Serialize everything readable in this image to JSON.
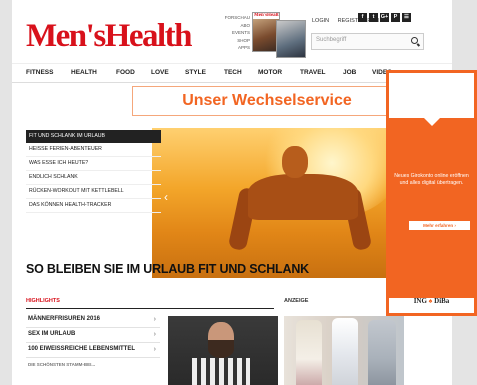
{
  "header": {
    "logo": "Men'sHealth",
    "top_links": [
      "FORSCHAU",
      "ABO",
      "EVENTS",
      "SHOP",
      "APPS"
    ],
    "magazine_mini_title": "Men'sHealth",
    "login_label": "LOGIN",
    "register_label": "REGISTRIEREN",
    "social": [
      "f",
      "t",
      "G+",
      "P",
      "RSS"
    ],
    "search_placeholder": "Suchbegriff"
  },
  "nav": {
    "items": [
      "FITNESS",
      "HEALTH",
      "FOOD",
      "LOVE",
      "STYLE",
      "TECH",
      "MOTOR",
      "TRAVEL",
      "JOB",
      "VIDEO"
    ]
  },
  "banner": {
    "text": "Unser Wechselservice"
  },
  "teasers": [
    "FIT UND SCHLANK IM URLAUB",
    "HEISSE FERIEN-ABENTEUER",
    "WAS ESSE ICH HEUTE?",
    "ENDLICH SCHLANK",
    "RÜCKEN-WORKOUT MIT KETTLEBELL",
    "DAS KÖNNEN HEALTH-TRACKER"
  ],
  "hero": {
    "title": "SO BLEIBEN SIE IM URLAUB FIT UND SCHLANK"
  },
  "highlights": {
    "heading": "HIGHLIGHTS",
    "items": [
      "MÄNNERFRISUREN 2016",
      "SEX IM URLAUB",
      "100 EIWEISSREICHE LEBENSMITTEL",
      "DIE SCHÖNSTEN STAMM-BEI..."
    ]
  },
  "anzeige": {
    "heading": "ANZEIGE"
  },
  "ad": {
    "copy": "Neues Girokonto online eröffnen und alles digital übertragen.",
    "cta": "Mehr erfahren ›",
    "brand_left": "ING",
    "brand_right": "DiBa"
  }
}
